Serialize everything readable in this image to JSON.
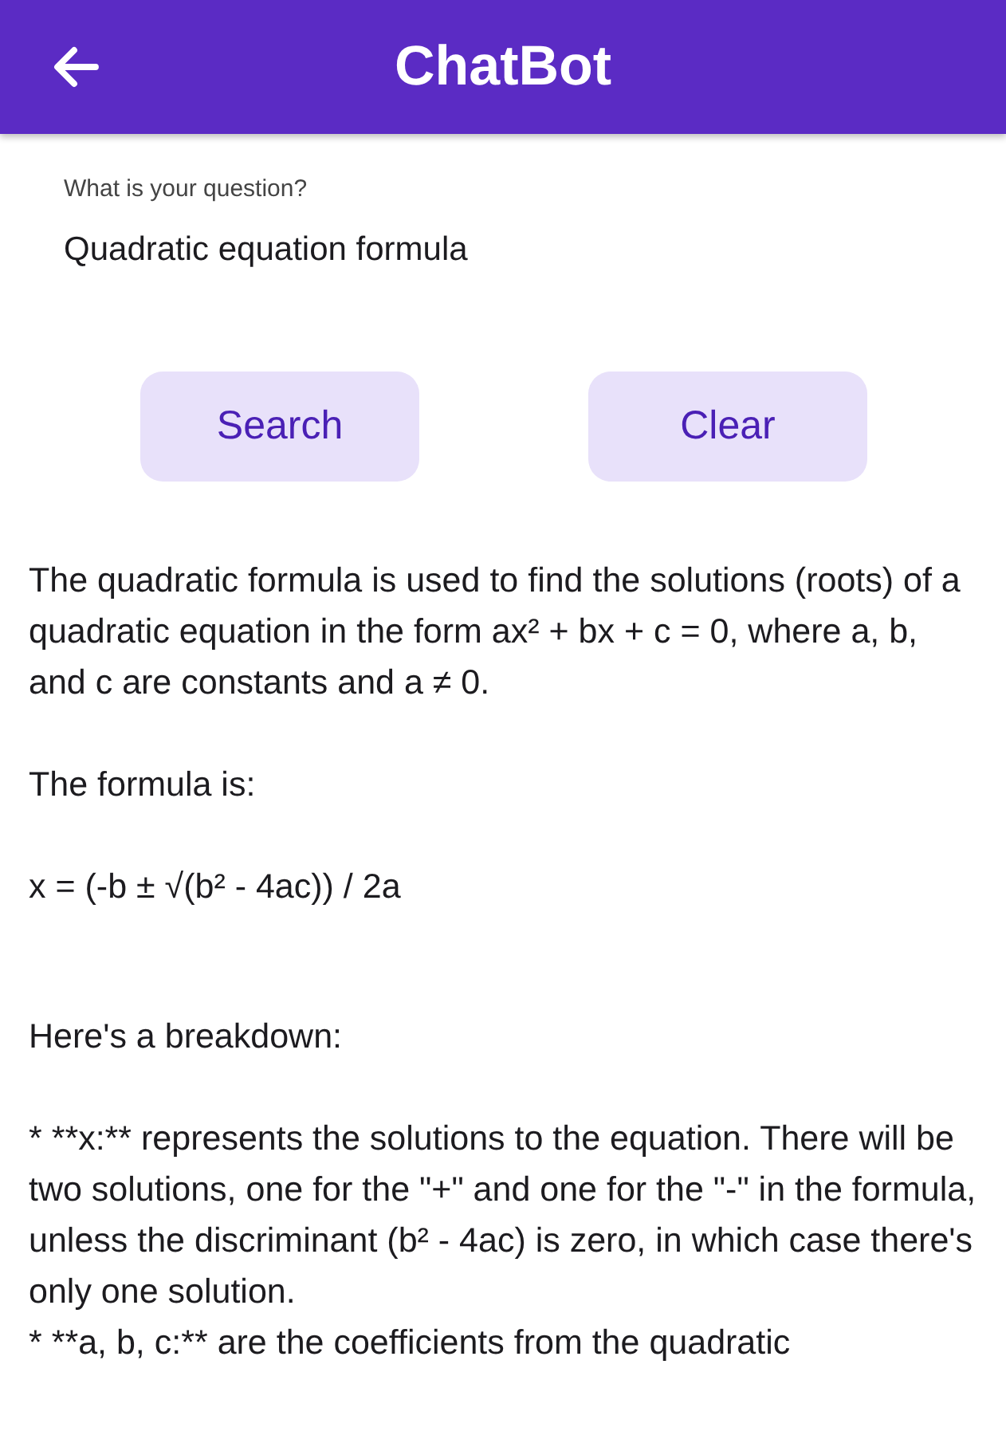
{
  "app_bar": {
    "title": "ChatBot"
  },
  "question_field": {
    "label": "What is your question?",
    "value": "Quadratic equation formula"
  },
  "buttons": [
    {
      "label": "Search"
    },
    {
      "label": "Clear"
    }
  ],
  "answer": [
    {
      "kind": "paragraph",
      "text": "The quadratic formula is used to find the solutions (roots) of a quadratic equation in the form ax² + bx + c = 0, where a, b, and c are constants and a ≠ 0."
    },
    {
      "kind": "paragraph",
      "text": "The formula is:"
    },
    {
      "kind": "formula",
      "text": "x = (-b ± √(b² - 4ac)) / 2a"
    },
    {
      "kind": "paragraph",
      "text": "Here's a breakdown:"
    },
    {
      "kind": "line",
      "text": "* **x:** represents the solutions to the equation. There will be two solutions, one for the \"+\" and one for the \"-\" in the formula, unless the discriminant (b² - 4ac) is zero, in which case there's only one solution."
    },
    {
      "kind": "line",
      "text": "* **a, b, c:** are the coefficients from the quadratic"
    }
  ]
}
